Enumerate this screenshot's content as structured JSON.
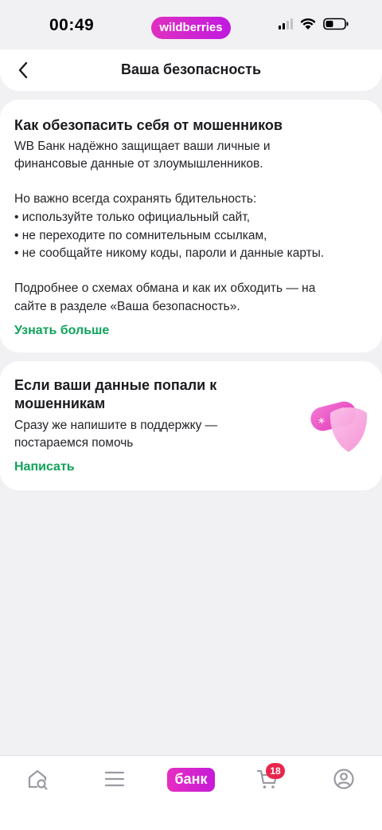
{
  "status_bar": {
    "time": "00:49",
    "brand": "wildberries"
  },
  "header": {
    "title": "Ваша безопасность",
    "back_icon": "chevron-left-icon"
  },
  "card_protection": {
    "title": "Как обезопасить себя от мошенников",
    "text_lines": [
      "WB Банк надёжно защищает ваши личные и",
      "финансовые данные от злоумышленников.",
      "Но важно всегда сохранять бдительность:",
      "• используйте только официальный сайт,",
      "• не переходите по сомнительным ссылкам,",
      "• не сообщайте никому коды, пароли и данные карты.",
      "Подробнее о схемах обмана и как их обходить — на",
      "сайте в разделе «Ваша безопасность»."
    ],
    "link": "Узнать больше"
  },
  "card_support": {
    "title_lines": [
      "Если ваши данные попали к",
      "мошенникам"
    ],
    "text_lines": [
      "Сразу же напишите в поддержку —",
      "постараемся помочь"
    ],
    "link": "Написать",
    "illustration": "shield-password-icon"
  },
  "bottom_nav": {
    "items": [
      "home-search-icon",
      "menu-icon",
      "bank-tab",
      "cart-icon",
      "profile-icon"
    ],
    "bank_label": "банк",
    "cart_badge": "18"
  },
  "colors": {
    "accent_green": "#10a35b",
    "brand_magenta": "#cb11ab",
    "badge_red": "#e8264d"
  }
}
